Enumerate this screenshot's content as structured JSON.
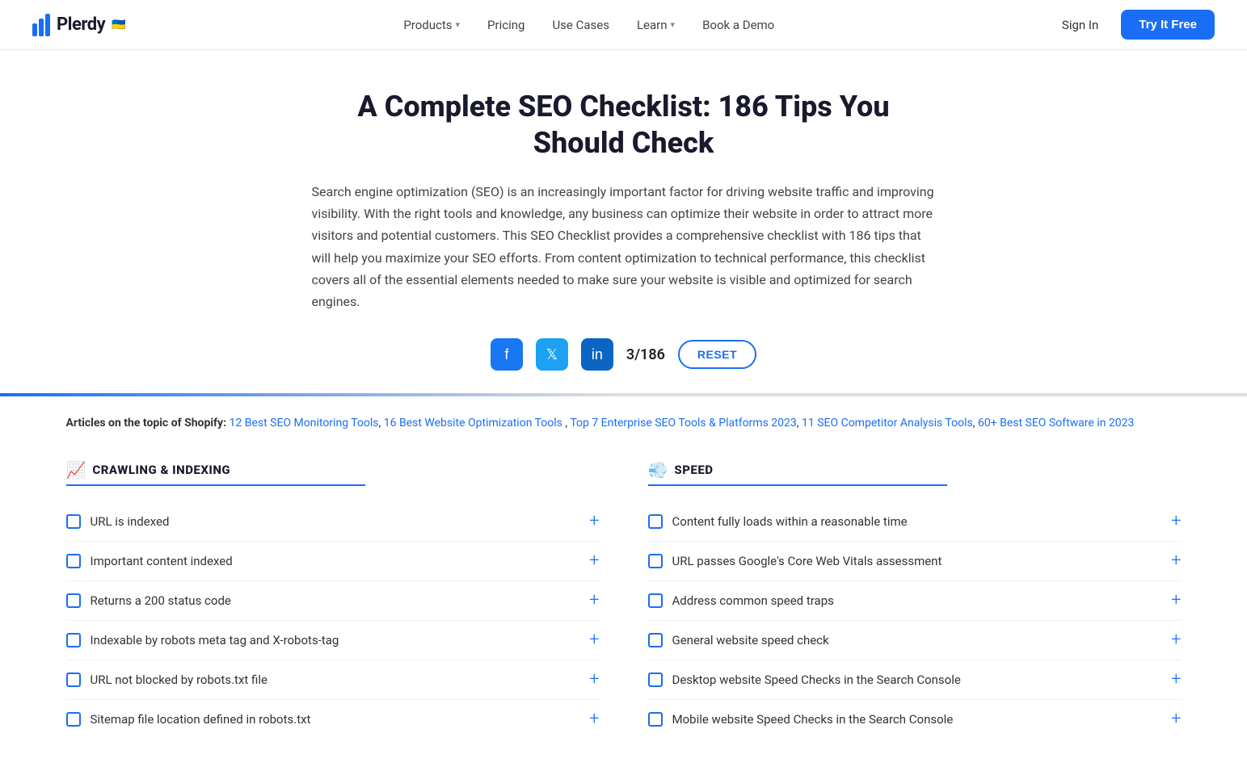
{
  "nav": {
    "logo_text": "Plerdy",
    "logo_flag": "🇺🇦",
    "items": [
      {
        "label": "Products",
        "has_chevron": true
      },
      {
        "label": "Pricing",
        "has_chevron": false
      },
      {
        "label": "Use Cases",
        "has_chevron": false
      },
      {
        "label": "Learn",
        "has_chevron": true
      },
      {
        "label": "Book a Demo",
        "has_chevron": false
      }
    ],
    "sign_in": "Sign In",
    "try_free": "Try It Free"
  },
  "hero": {
    "title": "A Complete SEO Checklist: 186 Tips You Should Check",
    "description": "Search engine optimization (SEO) is an increasingly important factor for driving website traffic and improving visibility. With the right tools and knowledge, any business can optimize their website in order to attract more visitors and potential customers. This SEO Checklist provides a comprehensive checklist with 186 tips that will help you maximize your SEO efforts. From content optimization to technical performance, this checklist covers all of the essential elements needed to make sure your website is visible and optimized for search engines.",
    "counter": "3/186",
    "reset_label": "RESET"
  },
  "articles": {
    "prefix": "Articles on the topic of Shopify:",
    "links": [
      "12 Best SEO Monitoring Tools",
      "16 Best Website Optimization Tools",
      "Top 7 Enterprise SEO Tools & Platforms 2023",
      "11 SEO Competitor Analysis Tools",
      "60+ Best SEO Software in 2023"
    ]
  },
  "sections": [
    {
      "id": "crawling",
      "icon": "📈",
      "title": "CRAWLING & INDEXING",
      "items": [
        "URL is indexed",
        "Important content indexed",
        "Returns a 200 status code",
        "Indexable by robots meta tag and X-robots-tag",
        "URL not blocked by robots.txt file",
        "Sitemap file location defined in robots.txt"
      ]
    },
    {
      "id": "speed",
      "icon": "💨",
      "title": "SPEED",
      "items": [
        "Content fully loads within a reasonable time",
        "URL passes Google's Core Web Vitals assessment",
        "Address common speed traps",
        "General website speed check",
        "Desktop website Speed Checks in the Search Console",
        "Mobile website Speed Checks in the Search Console"
      ]
    }
  ]
}
